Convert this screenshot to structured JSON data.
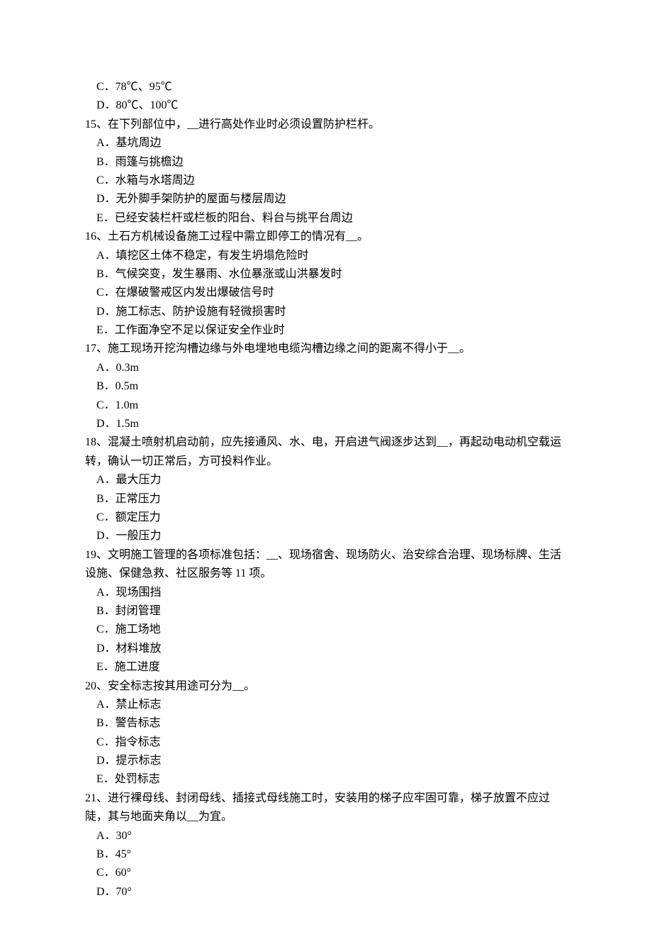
{
  "lines": [
    {
      "cls": "option",
      "path": "q14.optC"
    },
    {
      "cls": "option",
      "path": "q14.optD"
    },
    {
      "cls": "question",
      "path": "q15.text"
    },
    {
      "cls": "option",
      "path": "q15.optA"
    },
    {
      "cls": "option",
      "path": "q15.optB"
    },
    {
      "cls": "option",
      "path": "q15.optC"
    },
    {
      "cls": "option",
      "path": "q15.optD"
    },
    {
      "cls": "option",
      "path": "q15.optE"
    },
    {
      "cls": "question",
      "path": "q16.text"
    },
    {
      "cls": "option",
      "path": "q16.optA"
    },
    {
      "cls": "option",
      "path": "q16.optB"
    },
    {
      "cls": "option",
      "path": "q16.optC"
    },
    {
      "cls": "option",
      "path": "q16.optD"
    },
    {
      "cls": "option",
      "path": "q16.optE"
    },
    {
      "cls": "question",
      "path": "q17.text"
    },
    {
      "cls": "option",
      "path": "q17.optA"
    },
    {
      "cls": "option",
      "path": "q17.optB"
    },
    {
      "cls": "option",
      "path": "q17.optC"
    },
    {
      "cls": "option",
      "path": "q17.optD"
    },
    {
      "cls": "question",
      "path": "q18.text"
    },
    {
      "cls": "option",
      "path": "q18.optA"
    },
    {
      "cls": "option",
      "path": "q18.optB"
    },
    {
      "cls": "option",
      "path": "q18.optC"
    },
    {
      "cls": "option",
      "path": "q18.optD"
    },
    {
      "cls": "question",
      "path": "q19.text"
    },
    {
      "cls": "option",
      "path": "q19.optA"
    },
    {
      "cls": "option",
      "path": "q19.optB"
    },
    {
      "cls": "option",
      "path": "q19.optC"
    },
    {
      "cls": "option",
      "path": "q19.optD"
    },
    {
      "cls": "option",
      "path": "q19.optE"
    },
    {
      "cls": "question",
      "path": "q20.text"
    },
    {
      "cls": "option",
      "path": "q20.optA"
    },
    {
      "cls": "option",
      "path": "q20.optB"
    },
    {
      "cls": "option",
      "path": "q20.optC"
    },
    {
      "cls": "option",
      "path": "q20.optD"
    },
    {
      "cls": "option",
      "path": "q20.optE"
    },
    {
      "cls": "question",
      "path": "q21.text"
    },
    {
      "cls": "option",
      "path": "q21.optA"
    },
    {
      "cls": "option",
      "path": "q21.optB"
    },
    {
      "cls": "option",
      "path": "q21.optC"
    },
    {
      "cls": "option",
      "path": "q21.optD"
    }
  ],
  "q14": {
    "optC": "C．78℃、95℃",
    "optD": "D．80℃、100℃"
  },
  "q15": {
    "text": "15、在下列部位中，__进行高处作业时必须设置防护栏杆。",
    "optA": "A．基坑周边",
    "optB": "B．雨篷与挑檐边",
    "optC": "C．水箱与水塔周边",
    "optD": "D．无外脚手架防护的屋面与楼层周边",
    "optE": "E．已经安装栏杆或栏板的阳台、料台与挑平台周边"
  },
  "q16": {
    "text": "16、土石方机械设备施工过程中需立即停工的情况有__。",
    "optA": "A．填挖区土体不稳定，有发生坍塌危险时",
    "optB": "B．气候突变，发生暴雨、水位暴涨或山洪暴发时",
    "optC": "C．在爆破警戒区内发出爆破信号时",
    "optD": "D．施工标志、防护设施有轻微损害时",
    "optE": "E．工作面净空不足以保证安全作业时"
  },
  "q17": {
    "text": "17、施工现场开挖沟槽边缘与外电埋地电缆沟槽边缘之间的距离不得小于__。",
    "optA": "A．0.3m",
    "optB": "B．0.5m",
    "optC": "C．1.0m",
    "optD": "D．1.5m"
  },
  "q18": {
    "text": "18、混凝土喷射机启动前，应先接通风、水、电，开启进气阀逐步达到__，再起动电动机空载运转，确认一切正常后，方可投料作业。",
    "optA": "A．最大压力",
    "optB": "B．正常压力",
    "optC": "C．额定压力",
    "optD": "D．一般压力"
  },
  "q19": {
    "text": "19、文明施工管理的各项标准包括：__、现场宿舍、现场防火、治安综合治理、现场标牌、生活设施、保健急救、社区服务等 11 项。",
    "optA": "A．现场围挡",
    "optB": "B．封闭管理",
    "optC": "C．施工场地",
    "optD": "D．材料堆放",
    "optE": "E．施工进度"
  },
  "q20": {
    "text": "20、安全标志按其用途可分为__。",
    "optA": "A．禁止标志",
    "optB": "B．警告标志",
    "optC": "C．指令标志",
    "optD": "D．提示标志",
    "optE": "E．处罚标志"
  },
  "q21": {
    "text": "21、进行裸母线、封闭母线、插接式母线施工时，安装用的梯子应牢固可靠，梯子放置不应过陡，其与地面夹角以__为宜。",
    "optA": "A．30°",
    "optB": "B．45°",
    "optC": "C．60°",
    "optD": "D．70°"
  }
}
